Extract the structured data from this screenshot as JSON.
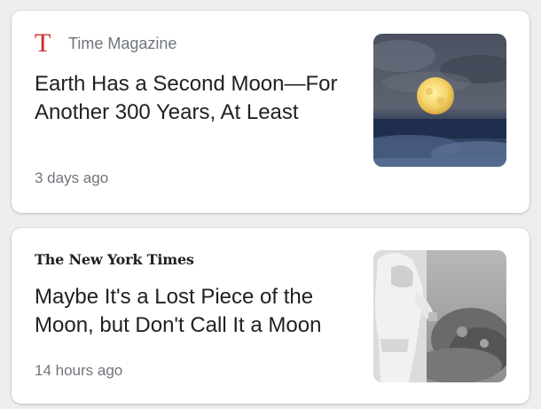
{
  "cards": [
    {
      "source": {
        "logo_letter": "T",
        "name": "Time Magazine",
        "logo_color": "#d0262a"
      },
      "headline": "Earth Has a Second Moon—For Another 300 Years, At Least",
      "timestamp": "3 days ago",
      "thumbnail": "full-moon-over-clouds-image"
    },
    {
      "source": {
        "logo_text": "The New York Times"
      },
      "headline": "Maybe It's a Lost Piece of the Moon, but Don't Call It a Moon",
      "timestamp": "14 hours ago",
      "thumbnail": "astronaut-on-moon-image"
    }
  ],
  "colors": {
    "text_primary": "#202124",
    "text_secondary": "#70757a",
    "card_background": "#ffffff",
    "page_background": "#eeeeee"
  }
}
